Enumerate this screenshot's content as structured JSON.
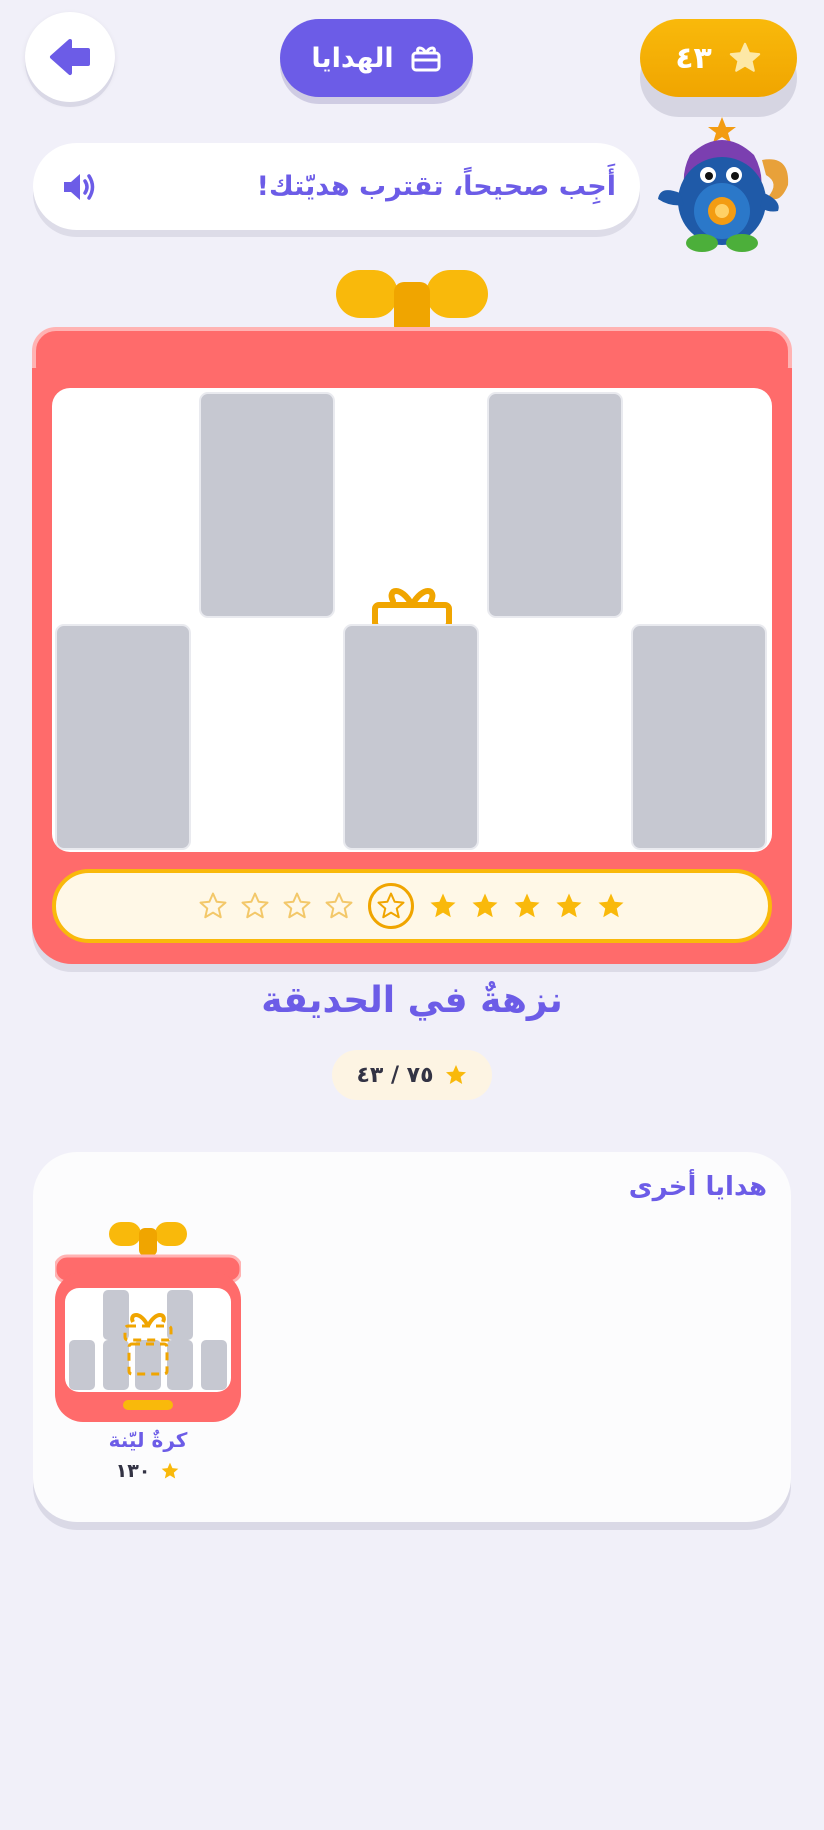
{
  "header": {
    "back_icon": "arrow-left-icon",
    "gifts_label": "الهدايا",
    "gifts_icon": "gift-icon",
    "score": "٤٣",
    "score_icon": "star-icon"
  },
  "speech": {
    "text": "أَجِب صحيحاً، تقترب هديّتك!",
    "icon": "speaker-icon"
  },
  "mascot": {
    "icon": "mascot-monster-icon"
  },
  "gift_box": {
    "center_icon": "gift-icon",
    "stars_earned": 5,
    "stars_total": 10,
    "tiles_remaining": 5
  },
  "gift": {
    "title": "نزهةٌ في الحديقة",
    "progress_current": "٤٣",
    "progress_total": "٧٥",
    "progress_text": "٧٥ / ٤٣"
  },
  "others": {
    "title": "هدايا أخرى",
    "items": [
      {
        "name": "كرةٌ ليّنة",
        "cost": "١٣٠"
      }
    ]
  },
  "colors": {
    "primary": "#6c5ce7",
    "gold": "#f9b90b",
    "box_red": "#ff6b6b",
    "tile_gray": "#c6c8d1",
    "background": "#f1f0f9"
  }
}
